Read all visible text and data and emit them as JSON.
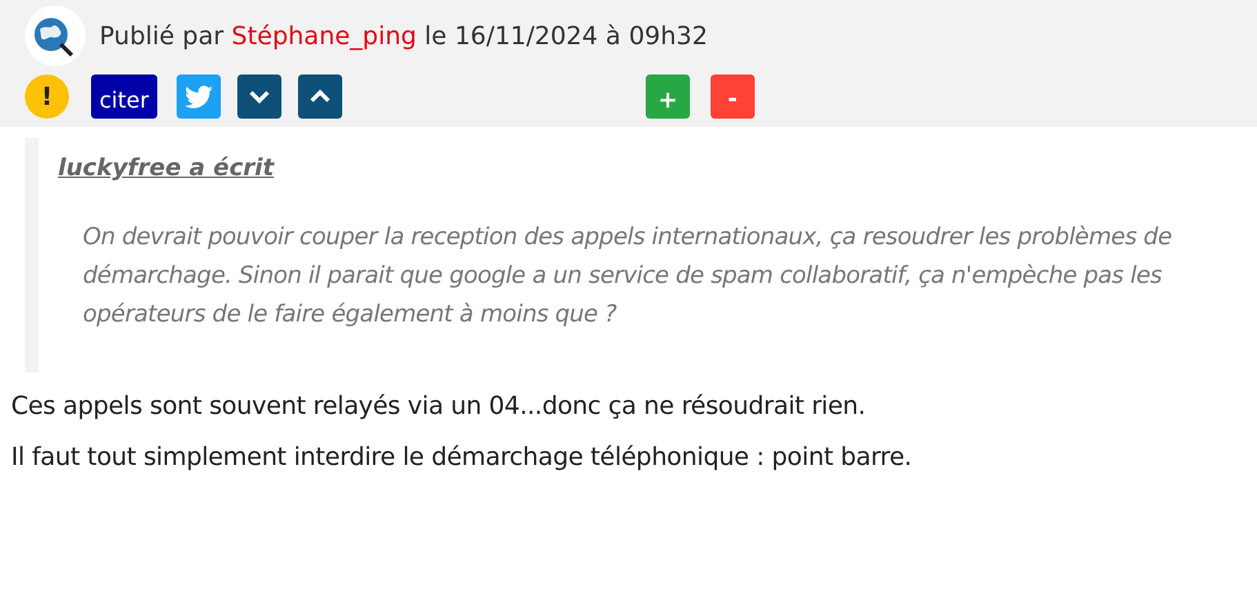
{
  "post": {
    "prefix": "Publié par",
    "author": "Stéphane_ping",
    "date_text": "le 16/11/2024 à 09h32"
  },
  "actions": [
    {
      "kind": "alert",
      "label": "!"
    },
    {
      "kind": "quote",
      "label": "citer"
    },
    {
      "kind": "twitter"
    },
    {
      "kind": "down"
    },
    {
      "kind": "up"
    }
  ],
  "votes": [
    {
      "kind": "plus",
      "label": "+"
    },
    {
      "kind": "minus",
      "label": "-"
    }
  ],
  "quote": {
    "author_line": "luckyfree a écrit",
    "text": "On devrait pouvoir couper la reception des appels internationaux, ça resoudrer les problèmes de démarchage. Sinon il parait que google a un service de spam collaboratif, ça n'empèche pas les opérateurs de le faire également à moins que ?"
  },
  "paragraphs": [
    "Ces appels sont souvent relayés via un 04...donc ça ne résoudrait rien.",
    "Il faut tout simplement interdire le démarchage téléphonique : point barre."
  ]
}
